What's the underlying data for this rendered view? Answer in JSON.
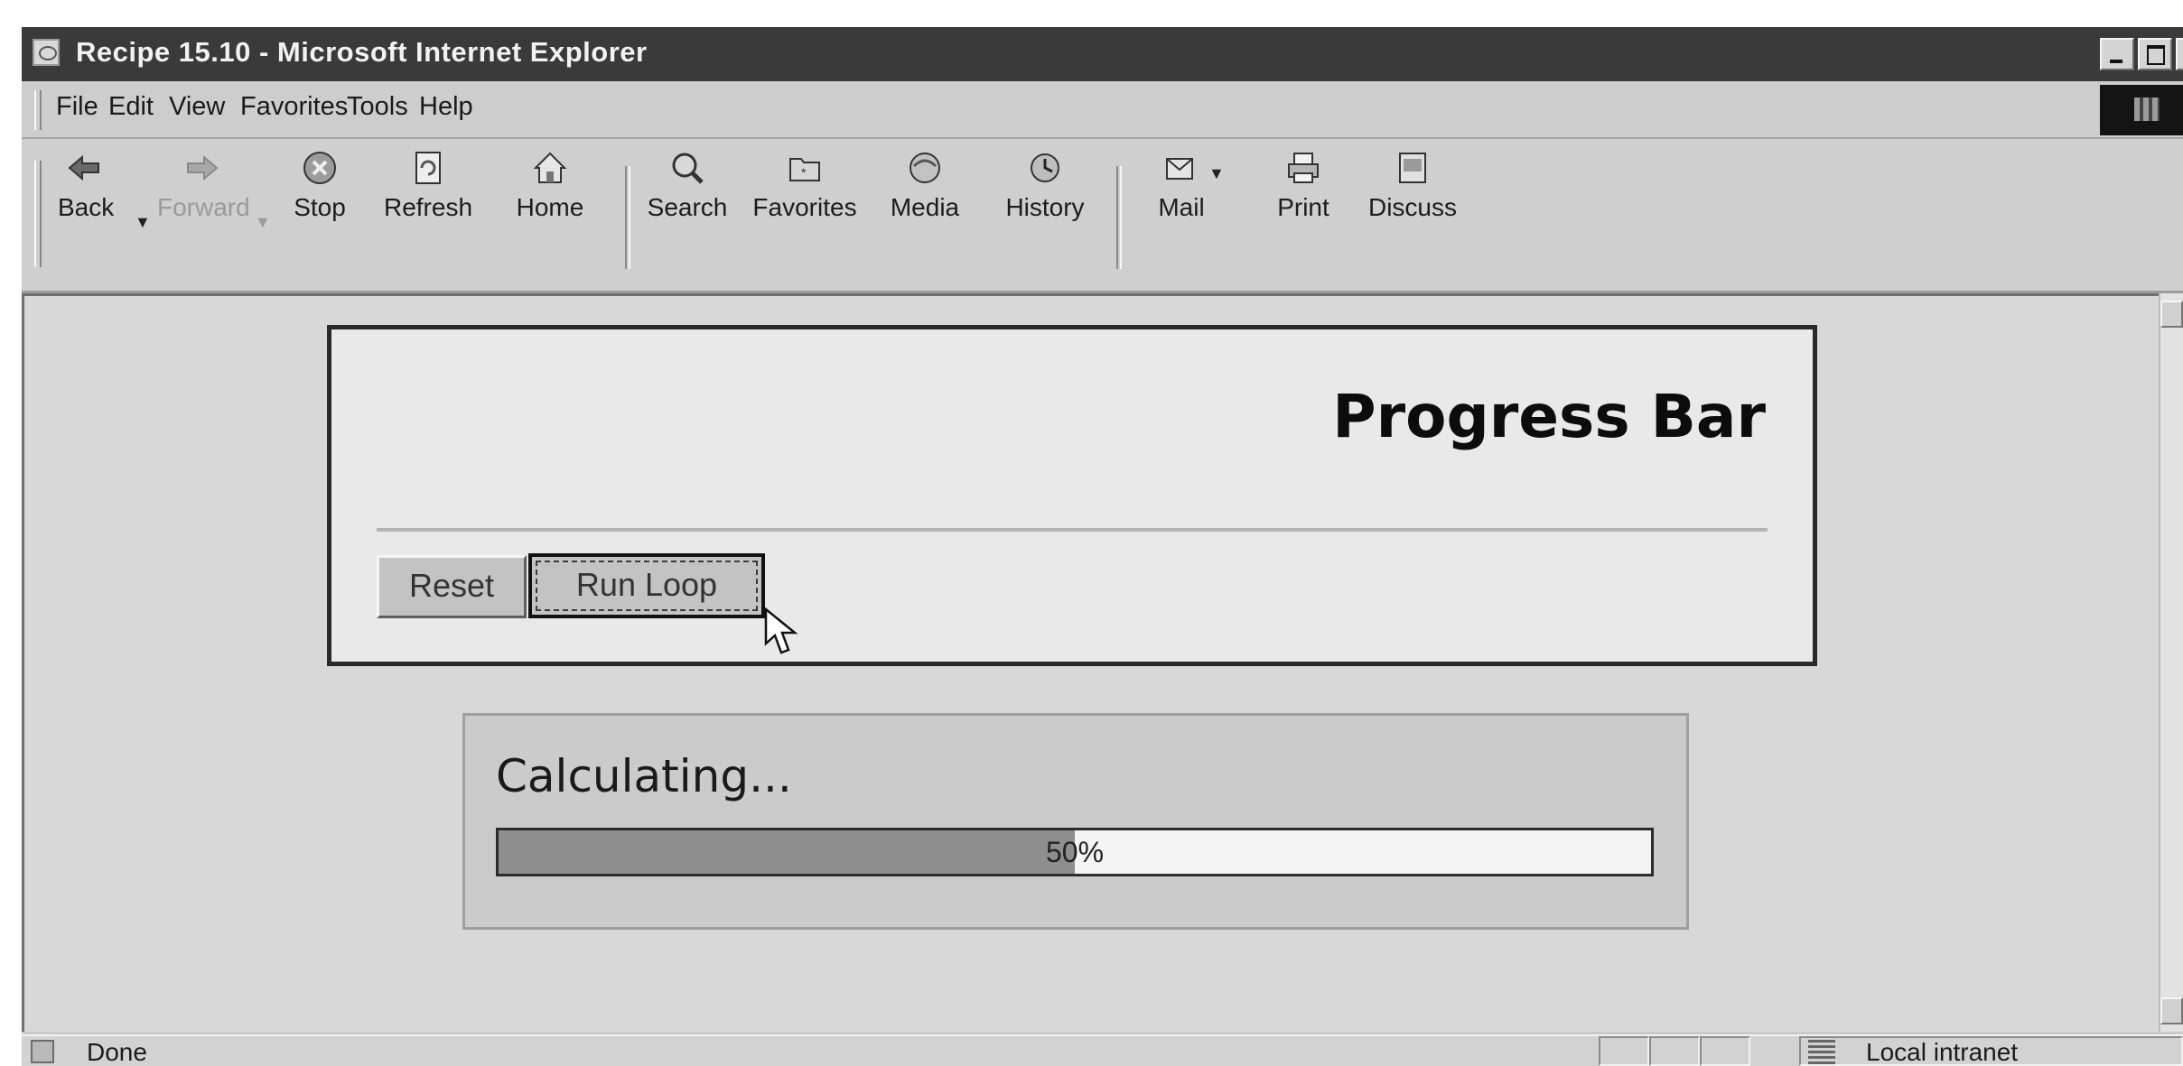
{
  "window": {
    "title": "Recipe 15.10 - Microsoft Internet Explorer"
  },
  "menu": {
    "items": [
      {
        "label": "File"
      },
      {
        "label": "Edit"
      },
      {
        "label": "View"
      },
      {
        "label": "Favorites"
      },
      {
        "label": "Tools"
      },
      {
        "label": "Help"
      }
    ]
  },
  "toolbar": {
    "buttons": [
      {
        "label": "Back",
        "icon": "back-arrow-icon",
        "enabled": true
      },
      {
        "label": "Forward",
        "icon": "forward-arrow-icon",
        "enabled": false
      },
      {
        "label": "Stop",
        "icon": "stop-icon",
        "enabled": true
      },
      {
        "label": "Refresh",
        "icon": "refresh-icon",
        "enabled": true
      },
      {
        "label": "Home",
        "icon": "home-icon",
        "enabled": true
      },
      {
        "label": "Search",
        "icon": "search-icon",
        "enabled": true
      },
      {
        "label": "Favorites",
        "icon": "favorites-icon",
        "enabled": true
      },
      {
        "label": "Media",
        "icon": "media-icon",
        "enabled": true
      },
      {
        "label": "History",
        "icon": "history-icon",
        "enabled": true
      },
      {
        "label": "Mail",
        "icon": "mail-icon",
        "enabled": true
      },
      {
        "label": "Print",
        "icon": "printer-icon",
        "enabled": true
      },
      {
        "label": "Discuss",
        "icon": "discuss-icon",
        "enabled": true
      }
    ]
  },
  "page": {
    "heading": "Progress Bar",
    "reset_label": "Reset",
    "run_label": "Run Loop"
  },
  "progress": {
    "label": "Calculating...",
    "percent_text": "50%",
    "value": 0.5
  },
  "status": {
    "text": "Done",
    "zone": "Local intranet"
  },
  "colors": {
    "titlebar": "#3a3a3a",
    "window_chrome": "#c9c9c9",
    "progress_fill": "#8e8e8e",
    "progress_track": "#f4f4f4"
  }
}
